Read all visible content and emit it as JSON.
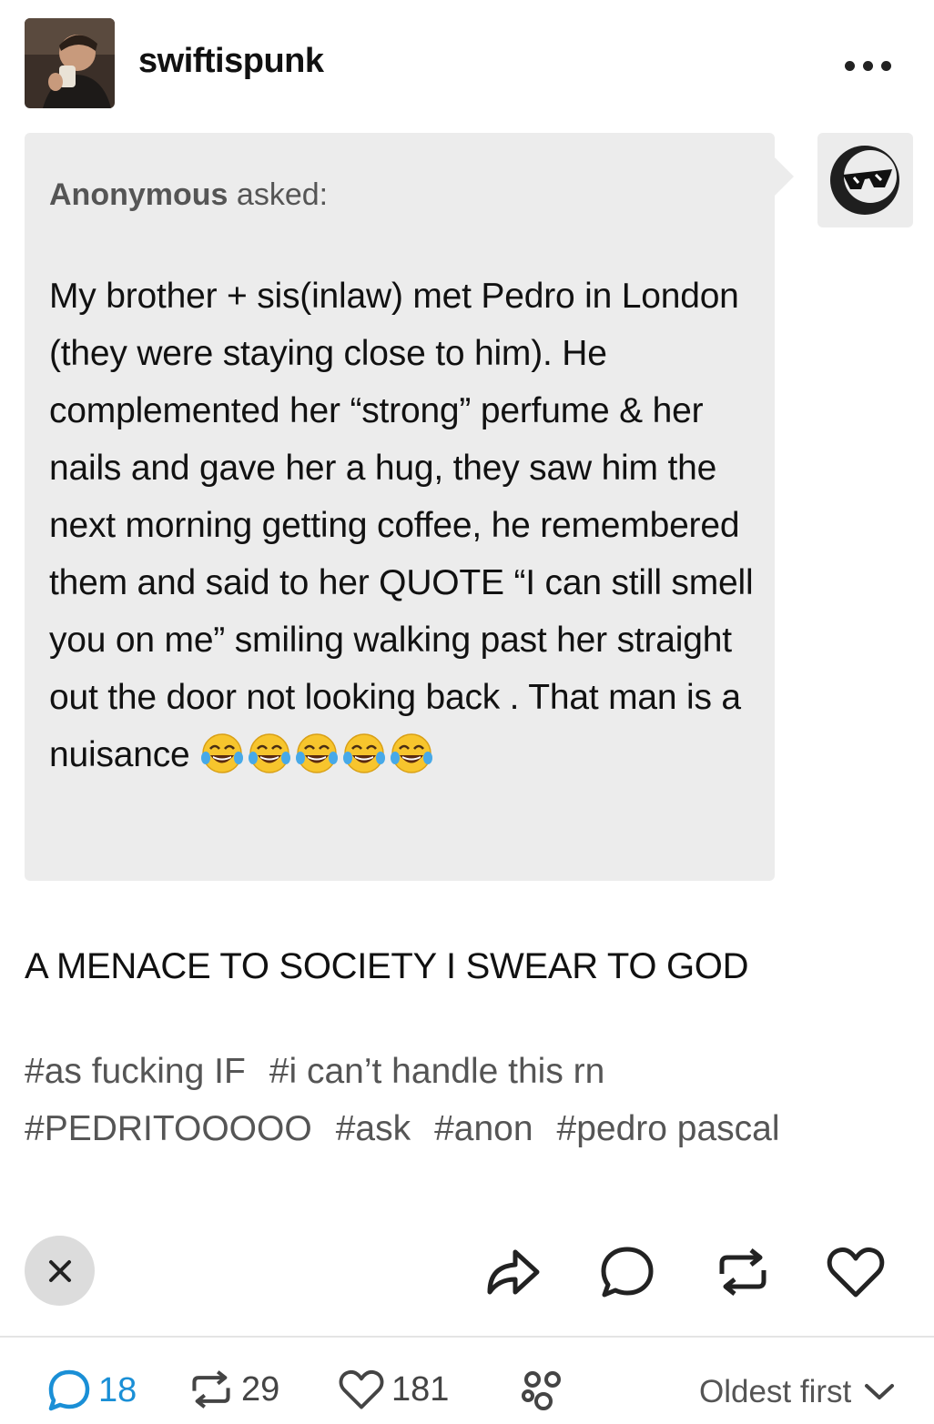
{
  "post": {
    "blog_name": "swiftispunk",
    "ask": {
      "asker_name": "Anonymous",
      "asked_label": "asked:",
      "question": "My brother + sis(inlaw) met Pedro in London (they were staying close to him). He complemented her “strong” perfume & her nails and gave her a hug, they saw him the next morning getting coffee, he remembered them and said to her QUOTE “I can still smell you on me” smiling walking past her straight out the door not looking back . That man is a nuisance",
      "emoji_count": 5
    },
    "answer": "A MENACE TO SOCIETY I SWEAR TO GOD",
    "tags": [
      "#as fucking IF",
      "#i can’t handle this rn",
      "#PEDRITOOOOO",
      "#ask",
      "#anon",
      "#pedro pascal"
    ]
  },
  "actions": {
    "icons": [
      "close-icon",
      "share-icon",
      "reply-icon",
      "reblog-icon",
      "heart-icon"
    ]
  },
  "footer": {
    "replies": "18",
    "reblogs": "29",
    "likes": "181",
    "sort_label": "Oldest first"
  },
  "colors": {
    "bubble_bg": "#ececec",
    "reply_accent": "#1a8fd6",
    "tag_text": "#555555"
  }
}
